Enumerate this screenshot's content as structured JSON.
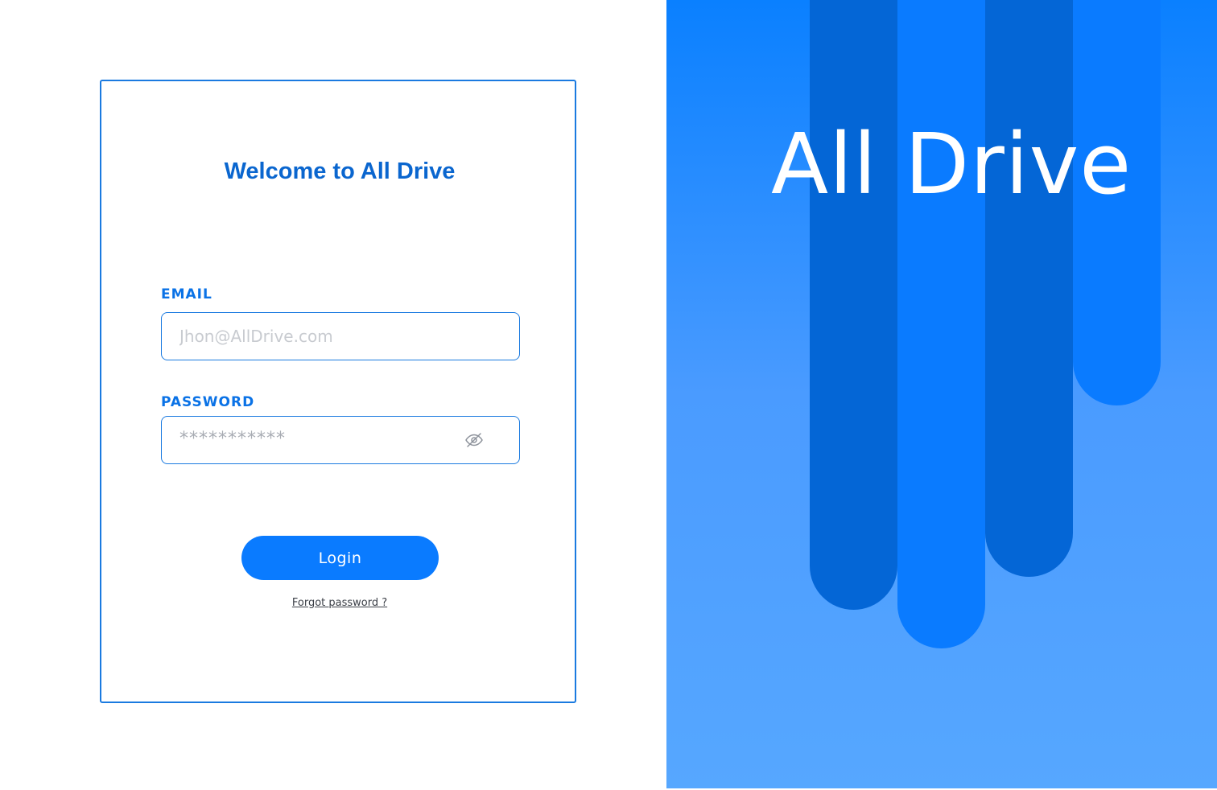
{
  "login": {
    "title": "Welcome to All Drive",
    "email_label": "EMAIL",
    "email_placeholder": "Jhon@AllDrive.com",
    "password_label": "PASSWORD",
    "password_mask": "***********",
    "login_button": "Login",
    "forgot_password": "Forgot password ?"
  },
  "brand": {
    "name": "All Drive"
  },
  "icons": {
    "password_toggle": "eye-off-icon"
  },
  "colors": {
    "primary": "#0a7bff",
    "primary_dark": "#0466d6",
    "title": "#0a66cf",
    "border": "#1a7ae0"
  }
}
